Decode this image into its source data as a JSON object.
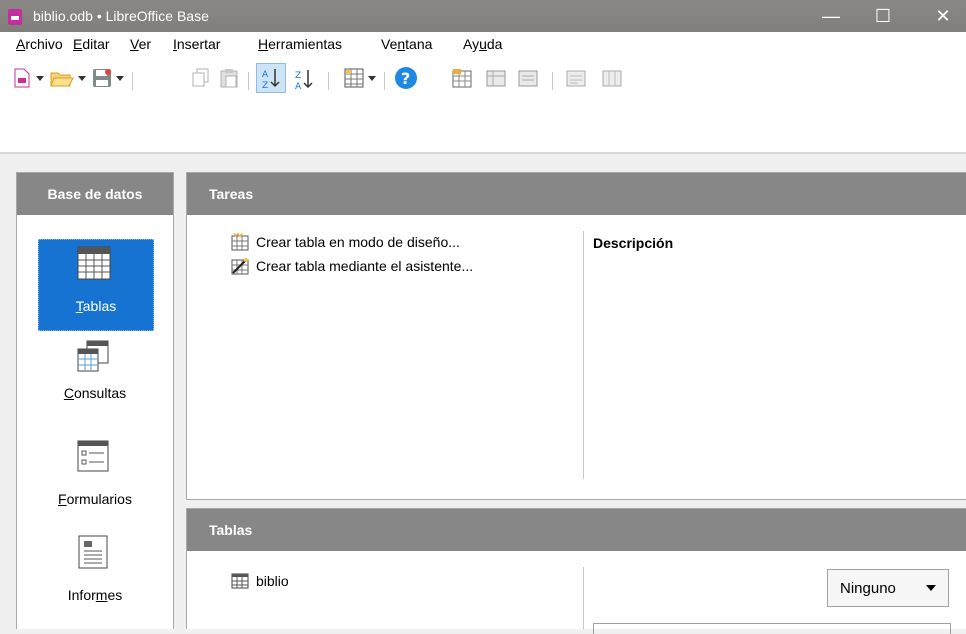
{
  "window": {
    "title": "biblio.odb • LibreOffice Base",
    "minimize": "—",
    "maximize": "☐",
    "close": "✕"
  },
  "menu": [
    {
      "pre": "",
      "key": "A",
      "post": "rchivo"
    },
    {
      "pre": "",
      "key": "E",
      "post": "ditar"
    },
    {
      "pre": "",
      "key": "V",
      "post": "er"
    },
    {
      "pre": "",
      "key": "I",
      "post": "nsertar"
    },
    {
      "pre": "",
      "key": "H",
      "post": "erramientas"
    },
    {
      "pre": "Ve",
      "key": "n",
      "post": "tana"
    },
    {
      "pre": "Ay",
      "key": "u",
      "post": "da"
    }
  ],
  "sidebar": {
    "header": "Base de datos",
    "items": [
      {
        "pre": "",
        "key": "T",
        "post": "ablas",
        "icon": "table-icon"
      },
      {
        "pre": "",
        "key": "C",
        "post": "onsultas",
        "icon": "query-icon"
      },
      {
        "pre": "",
        "key": "F",
        "post": "ormularios",
        "icon": "form-icon"
      },
      {
        "pre": "Infor",
        "key": "m",
        "post": "es",
        "icon": "report-icon"
      }
    ]
  },
  "tasks": {
    "header": "Tareas",
    "items": [
      "Crear tabla en modo de diseño...",
      "Crear tabla mediante el asistente..."
    ],
    "description_label": "Descripción"
  },
  "tables": {
    "header": "Tablas",
    "items": [
      "biblio"
    ],
    "preview_select": "Ninguno"
  },
  "colors": {
    "accent": "#1673d1",
    "panel_header": "#878787",
    "titlebar": "#84837f"
  }
}
